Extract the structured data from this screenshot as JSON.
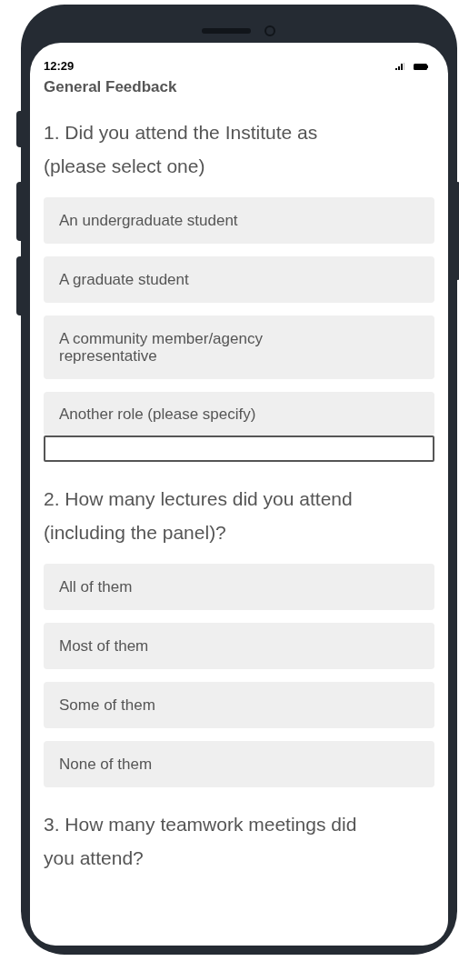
{
  "status_bar": {
    "time": "12:29"
  },
  "title": "General Feedback",
  "questions": [
    {
      "text": "1. Did you attend the Institute as (please select one)",
      "options": [
        {
          "kind": "choice",
          "label": "An undergraduate student"
        },
        {
          "kind": "choice",
          "label": "A graduate student"
        },
        {
          "kind": "choice",
          "label": "A community member/agency representative"
        },
        {
          "kind": "choice_with_field",
          "label": "Another role (please specify)"
        }
      ]
    },
    {
      "text": "2. How many lectures did you attend (including the panel)?",
      "options": [
        {
          "kind": "choice",
          "label": "All of them"
        },
        {
          "kind": "choice",
          "label": "Most of them"
        },
        {
          "kind": "choice",
          "label": "Some of them"
        },
        {
          "kind": "choice",
          "label": "None of them"
        }
      ]
    },
    {
      "text": "3. How many teamwork meetings did you attend?"
    }
  ]
}
